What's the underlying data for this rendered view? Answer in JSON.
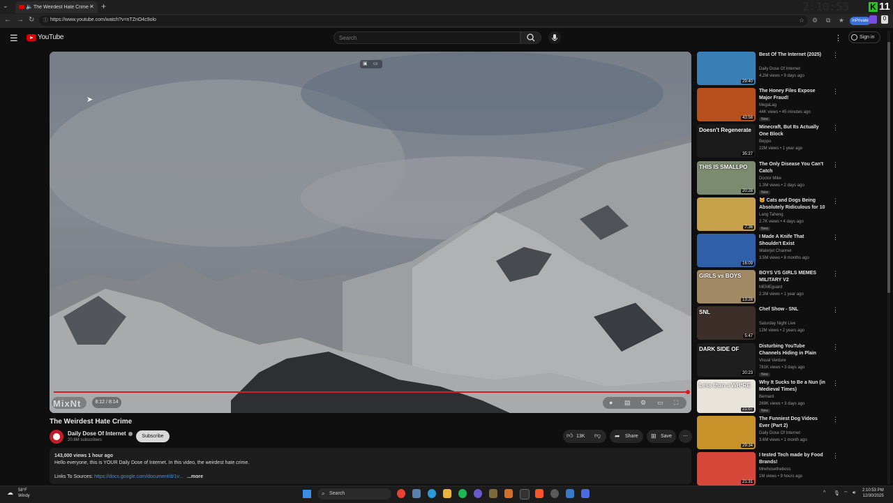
{
  "browser": {
    "tab_title": "The Weirdest Hate Crime - YouTube",
    "url": "https://www.youtube.com/watch?v=nTZnO4c9olo",
    "inprivate_label": "InPrivate",
    "overlay_clock": "2:10:55",
    "badge_letter": "K",
    "badge_number": "11"
  },
  "header": {
    "logo_text": "YouTube",
    "search_placeholder": "Search",
    "sign_in": "Sign in"
  },
  "player": {
    "time": "8:12 / 8:14",
    "watermark_text": "MixNt",
    "progress_fraction": 0.998
  },
  "video": {
    "title": "The Weirdest Hate Crime",
    "channel": "Daily Dose Of Internet",
    "subscribers": "20.6M subscribers",
    "subscribe_label": "Subscribe",
    "likes": "13K",
    "share_label": "Share",
    "save_label": "Save",
    "views_age": "143,000 views  1 hour ago",
    "description": "Hello everyone, this is YOUR Daily Dose of Internet. In this video, the weirdest hate crime.",
    "sources_label": "Links To Sources: ",
    "sources_link": "https://docs.google.com/document/d/1v...",
    "more_label": "...more"
  },
  "sidebar": [
    {
      "title": "Best Of The Internet (2025)",
      "channel": "Daily Dose Of Internet",
      "meta": "4.2M views • 9 days ago",
      "duration": "29:40",
      "new": "",
      "color": "#3a7fb6"
    },
    {
      "title": "The Honey Files Expose Major Fraud!",
      "channel": "MegaLag",
      "meta": "44K views • 45 minutes ago",
      "duration": "43:58",
      "new": "New",
      "color": "#b8501e"
    },
    {
      "title": "Minecraft, But Its Actually One Block",
      "channel": "Beppo",
      "meta": "22M views • 1 year ago",
      "duration": "35:27",
      "new": "",
      "color": "#1a1a1a",
      "overlay": "Doesn't Regenerate"
    },
    {
      "title": "The Only Disease You Can't Catch",
      "channel": "Doctor Mike",
      "meta": "1.3M views • 2 days ago",
      "duration": "20:28",
      "new": "New",
      "color": "#7b8b70",
      "overlay": "THIS IS SMALLPO"
    },
    {
      "title": "🐱 Cats and Dogs Being Absolutely Ridiculous for 10 ...",
      "channel": "Lang Taheng",
      "meta": "2.7K views • 4 days ago",
      "duration": "7:36",
      "new": "New",
      "color": "#c8a24a"
    },
    {
      "title": "I Made A Knife That Shouldn't Exist",
      "channel": "Waterjet Channel",
      "meta": "3.5M views • 8 months ago",
      "duration": "16:09",
      "new": "",
      "color": "#2e5fa8"
    },
    {
      "title": "BOYS VS GIRLS MEMES MILITARY V2",
      "channel": "MEMEguard",
      "meta": "2.3M views • 1 year ago",
      "duration": "13:28",
      "new": "",
      "color": "#a28a64",
      "overlay": "GIRLS vs BOYS"
    },
    {
      "title": "Chef Show - SNL",
      "channel": "Saturday Night Live",
      "meta": "12M views • 2 years ago",
      "duration": "5:47",
      "new": "",
      "color": "#3c2e28",
      "overlay": "SNL"
    },
    {
      "title": "Disturbing YouTube Channels Hiding in Plain Sight",
      "channel": "Visual Venture",
      "meta": "781K views • 3 days ago",
      "duration": "20:23",
      "new": "New",
      "color": "#1e1e1e",
      "overlay": "DARK SIDE OF"
    },
    {
      "title": "Why It Sucks to Be a Nun (in Medieval Times)",
      "channel": "Bernard",
      "meta": "269K views • 3 days ago",
      "duration": "21:07",
      "new": "New",
      "color": "#e8e4dc",
      "overlay": "Less than a WH*RE"
    },
    {
      "title": "The Funniest Dog Videos Ever (Part 2)",
      "channel": "Daily Dose Of Internet",
      "meta": "3.6M views • 1 month ago",
      "duration": "29:34",
      "new": "",
      "color": "#c8922a"
    },
    {
      "title": "I tested Tech made by Food Brands!",
      "channel": "Mrwhosetheboss",
      "meta": "1M views • 9 hours ago",
      "duration": "21:31",
      "new": "",
      "color": "#d8483a"
    }
  ],
  "taskbar": {
    "temperature": "58°F",
    "weather": "Windy",
    "search_label": "Search",
    "time": "2:10:53 PM",
    "date": "12/30/2025"
  }
}
